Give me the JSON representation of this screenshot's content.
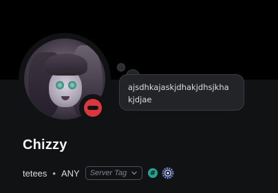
{
  "profile": {
    "display_name": "Chizzy",
    "username": "tetees",
    "separator": "•",
    "pronouns": "ANY",
    "avatar_alt": "profile avatar",
    "status_state": "do-not-disturb",
    "status_color": "#da373c"
  },
  "custom_status": {
    "line1": "ajsdhkajaskjdhakjdhsjkha",
    "line2": "kjdjae"
  },
  "server_tag": {
    "placeholder": "Server Tag",
    "icon": "chevron-down-icon"
  },
  "badges": [
    {
      "name": "hashtag-badge",
      "glyph": "#",
      "color": "#23a591"
    },
    {
      "name": "nitro-gear-badge",
      "color": "#7289da"
    }
  ],
  "colors": {
    "background": "#111214",
    "banner": "#000000",
    "text_primary": "#f2f3f5",
    "text_secondary": "#dbdee1",
    "muted": "#80848e"
  }
}
